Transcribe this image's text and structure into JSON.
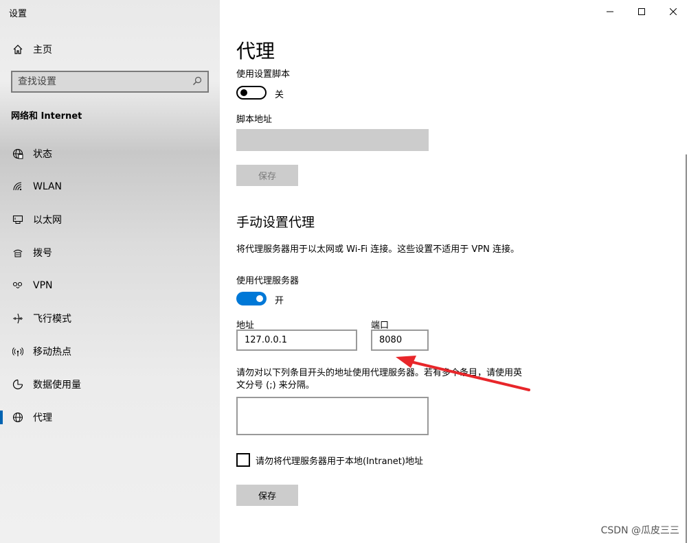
{
  "window": {
    "title": "设置"
  },
  "sidebar": {
    "home_label": "主页",
    "search_placeholder": "查找设置",
    "section_title": "网络和 Internet",
    "items": [
      {
        "label": "状态",
        "icon": "status-globe-icon"
      },
      {
        "label": "WLAN",
        "icon": "wifi-icon"
      },
      {
        "label": "以太网",
        "icon": "ethernet-icon"
      },
      {
        "label": "拨号",
        "icon": "dialup-icon"
      },
      {
        "label": "VPN",
        "icon": "vpn-icon"
      },
      {
        "label": "飞行模式",
        "icon": "airplane-icon"
      },
      {
        "label": "移动热点",
        "icon": "hotspot-icon"
      },
      {
        "label": "数据使用量",
        "icon": "data-usage-icon"
      },
      {
        "label": "代理",
        "icon": "globe-icon",
        "active": true
      }
    ]
  },
  "main": {
    "title": "代理",
    "auto": {
      "script_label": "使用设置脚本",
      "script_state": "关",
      "address_label": "脚本地址",
      "save_label": "保存"
    },
    "manual": {
      "heading": "手动设置代理",
      "description": "将代理服务器用于以太网或 Wi-Fi 连接。这些设置不适用于 VPN 连接。",
      "use_proxy_label": "使用代理服务器",
      "use_proxy_state": "开",
      "address_label": "地址",
      "address_value": "127.0.0.1",
      "port_label": "端口",
      "port_value": "8080",
      "exceptions_line1": "请勿对以下列条目开头的地址使用代理服务器。若有多个条目，请使用英",
      "exceptions_line2": "文分号 (;) 来分隔。",
      "exceptions_value": "",
      "local_checkbox_label": "请勿将代理服务器用于本地(Intranet)地址",
      "save_label": "保存"
    }
  },
  "watermark": "CSDN @瓜皮三三",
  "colors": {
    "accent": "#0078d7",
    "arrow": "#e8262a"
  }
}
